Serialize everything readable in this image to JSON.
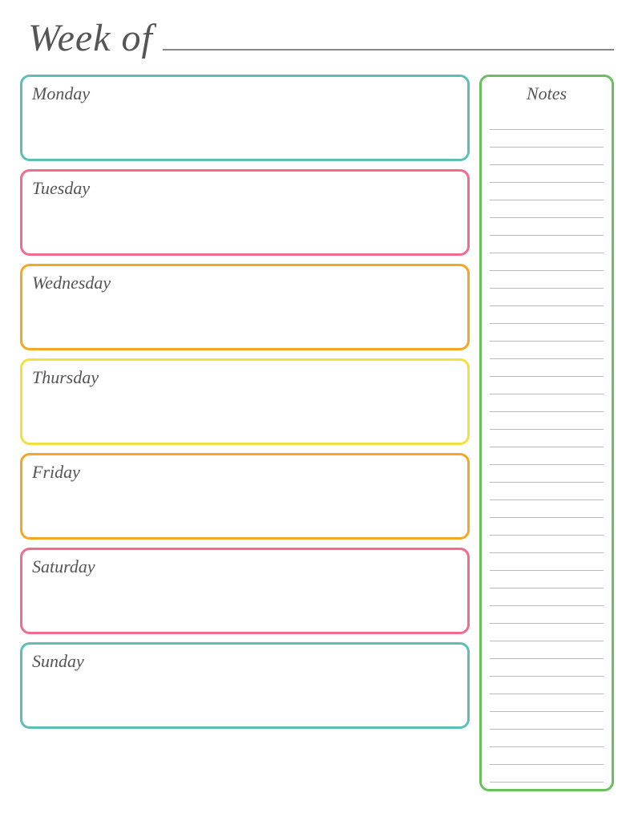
{
  "header": {
    "title": "Week of",
    "line_placeholder": ""
  },
  "days": [
    {
      "id": "monday",
      "label": "Monday",
      "color_class": "monday"
    },
    {
      "id": "tuesday",
      "label": "Tuesday",
      "color_class": "tuesday"
    },
    {
      "id": "wednesday",
      "label": "Wednesday",
      "color_class": "wednesday"
    },
    {
      "id": "thursday",
      "label": "Thursday",
      "color_class": "thursday"
    },
    {
      "id": "friday",
      "label": "Friday",
      "color_class": "friday"
    },
    {
      "id": "saturday",
      "label": "Saturday",
      "color_class": "saturday"
    },
    {
      "id": "sunday",
      "label": "Sunday",
      "color_class": "sunday"
    }
  ],
  "notes": {
    "title": "Notes",
    "line_count": 38
  }
}
